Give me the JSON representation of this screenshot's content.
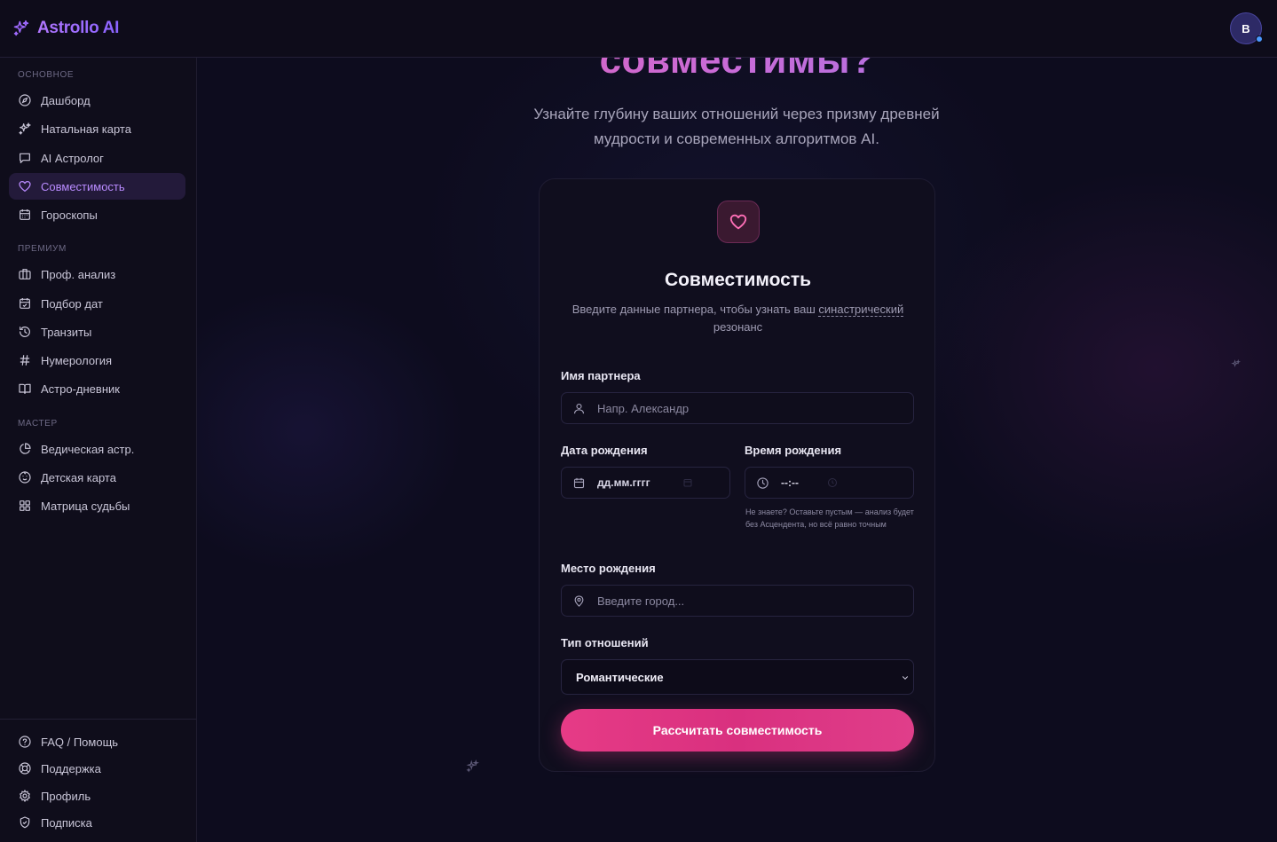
{
  "app": {
    "name": "Astrollo AI",
    "user_initial": "B"
  },
  "sidebar": {
    "sections": [
      {
        "title": "ОСНОВНОЕ",
        "items": [
          {
            "label": "Дашборд",
            "icon": "compass-icon"
          },
          {
            "label": "Натальная карта",
            "icon": "sparkles-icon"
          },
          {
            "label": "AI Астролог",
            "icon": "chat-icon"
          },
          {
            "label": "Совместимость",
            "icon": "heart-icon",
            "active": true
          },
          {
            "label": "Гороскопы",
            "icon": "calendar-icon"
          }
        ]
      },
      {
        "title": "ПРЕМИУМ",
        "items": [
          {
            "label": "Проф. анализ",
            "icon": "briefcase-icon"
          },
          {
            "label": "Подбор дат",
            "icon": "calendar-check-icon"
          },
          {
            "label": "Транзиты",
            "icon": "history-icon"
          },
          {
            "label": "Нумерология",
            "icon": "hash-icon"
          },
          {
            "label": "Астро-дневник",
            "icon": "book-icon"
          }
        ]
      },
      {
        "title": "МАСТЕР",
        "items": [
          {
            "label": "Ведическая астр.",
            "icon": "pie-chart-icon"
          },
          {
            "label": "Детская карта",
            "icon": "baby-icon"
          },
          {
            "label": "Матрица судьбы",
            "icon": "grid-icon"
          }
        ]
      }
    ],
    "footer": [
      {
        "label": "FAQ / Помощь",
        "icon": "help-circle-icon"
      },
      {
        "label": "Поддержка",
        "icon": "life-buoy-icon"
      },
      {
        "label": "Профиль",
        "icon": "settings-icon"
      },
      {
        "label": "Подписка",
        "icon": "shield-icon"
      }
    ]
  },
  "hero": {
    "title": "совместимы?",
    "subtitle": "Узнайте глубину ваших отношений через призму древней мудрости и современных алгоритмов AI."
  },
  "form": {
    "title": "Совместимость",
    "subtitle_before": "Введите данные партнера, чтобы узнать ваш ",
    "subtitle_term": "синастрический",
    "subtitle_after": " резонанс",
    "partner_name_label": "Имя партнера",
    "partner_name_placeholder": "Напр. Александр",
    "birth_date_label": "Дата рождения",
    "birth_date_value": "дд.мм.гггг",
    "birth_time_label": "Время рождения",
    "birth_time_value": "--:--",
    "birth_time_hint": "Не знаете? Оставьте пустым — анализ будет без Асцендента, но всё равно точным",
    "birth_place_label": "Место рождения",
    "birth_place_placeholder": "Введите город...",
    "relation_label": "Тип отношений",
    "relation_value": "Романтические",
    "submit_label": "Рассчитать совместимость"
  },
  "colors": {
    "accent": "#b277ff",
    "primary_button": "#e03684",
    "background": "#0d0c1e"
  }
}
